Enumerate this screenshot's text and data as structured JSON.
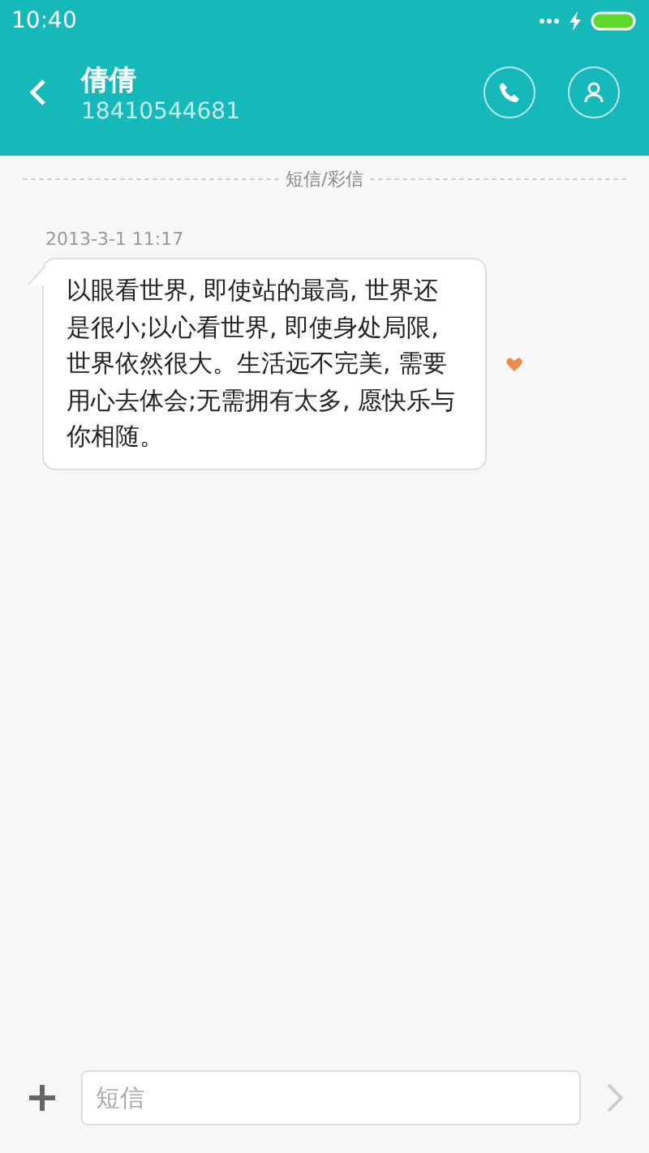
{
  "status_bar": {
    "time": "10:40"
  },
  "header": {
    "name": "倩倩",
    "number": "18410544681"
  },
  "divider_label": "短信/彩信",
  "messages": [
    {
      "time": "2013-3-1 11:17",
      "text": "以眼看世界, 即使站的最高, 世界还是很小;以心看世界, 即使身处局限, 世界依然很大。生活远不完美, 需要用心去体会;无需拥有太多, 愿快乐与你相随。",
      "favorite": true
    }
  ],
  "composer": {
    "placeholder": "短信"
  }
}
